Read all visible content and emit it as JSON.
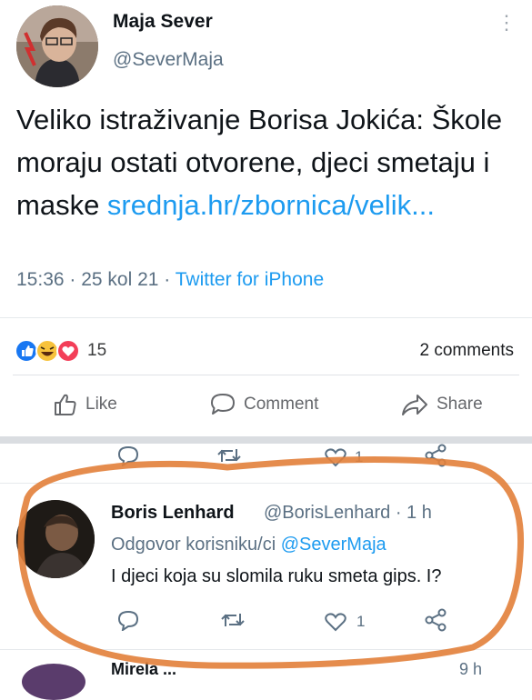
{
  "post": {
    "author_name": "Maja Sever",
    "author_handle": "@SeverMaja",
    "text_main": "Veliko istraživanje Borisa Jokića: Škole moraju ostati otvorene, djeci smetaju i maske ",
    "text_link": "srednja.hr/zbornica/velik...",
    "time": "15:36 · 25 kol 21 · ",
    "source": "Twitter for iPhone"
  },
  "facebook": {
    "reaction_count": "15",
    "comment_count": "2 comments",
    "actions": {
      "like": "Like",
      "comment": "Comment",
      "share": "Share"
    }
  },
  "reply_top_actions": {
    "like_count": "1"
  },
  "reply": {
    "author_name": "Boris Lenhard",
    "author_handle_time": "@BorisLenhard · 1 h",
    "reply_prefix": "Odgovor korisniku/ci ",
    "reply_to": "@SeverMaja",
    "text": "I djeci koja su slomila ruku smeta gips. I?",
    "like_count": "1"
  },
  "peek": {
    "name": "Mirela ...",
    "meta": "9 h"
  },
  "colors": {
    "link": "#1d9bf0",
    "oval": "#e2803a",
    "secondary": "#5b7083"
  }
}
